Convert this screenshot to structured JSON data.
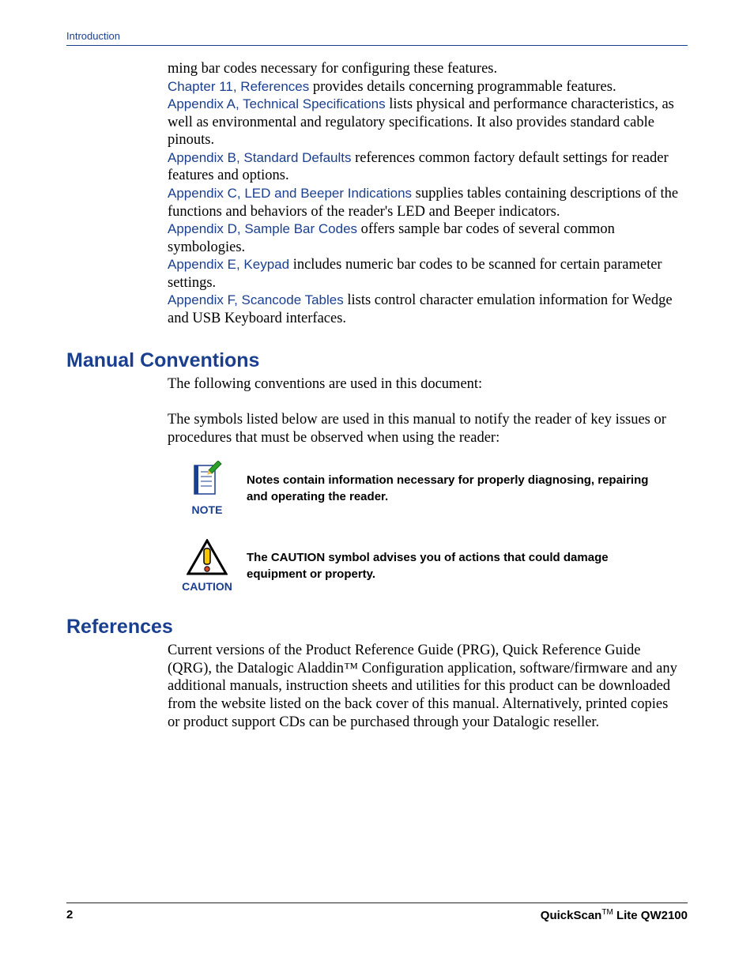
{
  "header": {
    "running": "Introduction"
  },
  "body": {
    "intro_frag": "ming bar codes necessary for configuring these features.",
    "entries": [
      {
        "link": "Chapter 11, References",
        "text": " provides details concerning programmable features."
      },
      {
        "link": "Appendix A, Technical Specifications",
        "text": " lists physical and performance characteristics, as well as environmental and regulatory specifications. It also provides standard cable pinouts."
      },
      {
        "link": "Appendix B, Standard Defaults",
        "text": " references common factory default settings for reader features and options."
      },
      {
        "link": "Appendix C, LED and Beeper Indications",
        "text": " supplies tables containing descriptions of the functions and behaviors of the reader's LED and Beeper indicators."
      },
      {
        "link": "Appendix D, Sample Bar Codes",
        "text": " offers sample bar codes of several common symbologies."
      },
      {
        "link": "Appendix E, Keypad",
        "text": " includes numeric bar codes to be scanned for certain parameter settings."
      },
      {
        "link": "Appendix F, Scancode Tables",
        "text": " lists control character emulation information for Wedge and USB Keyboard interfaces."
      }
    ]
  },
  "conventions": {
    "heading": "Manual Conventions",
    "p1": "The following conventions are used in this document:",
    "p2": "The symbols listed below are used in this manual to notify the reader of key  issues or procedures that must be observed when using the reader:",
    "note_label": "NOTE",
    "note_text": "Notes contain information necessary for properly diagnosing, repairing and operating the reader.",
    "caution_label": "CAUTION",
    "caution_text": "The CAUTION symbol advises you of actions that could damage equipment or property."
  },
  "references": {
    "heading": "References",
    "p": "Current versions of the Product Reference Guide (PRG), Quick Reference Guide (QRG), the Datalogic Aladdin™ Configuration application, software/firmware and any additional manuals, instruction sheets and utilities for this product can be downloaded from the website listed on the back cover of this manual. Alternatively, printed copies or product support CDs can be purchased through your Datalogic reseller."
  },
  "footer": {
    "page": "2",
    "brand": "QuickScan",
    "tm": "TM",
    "model": " Lite QW2100"
  }
}
